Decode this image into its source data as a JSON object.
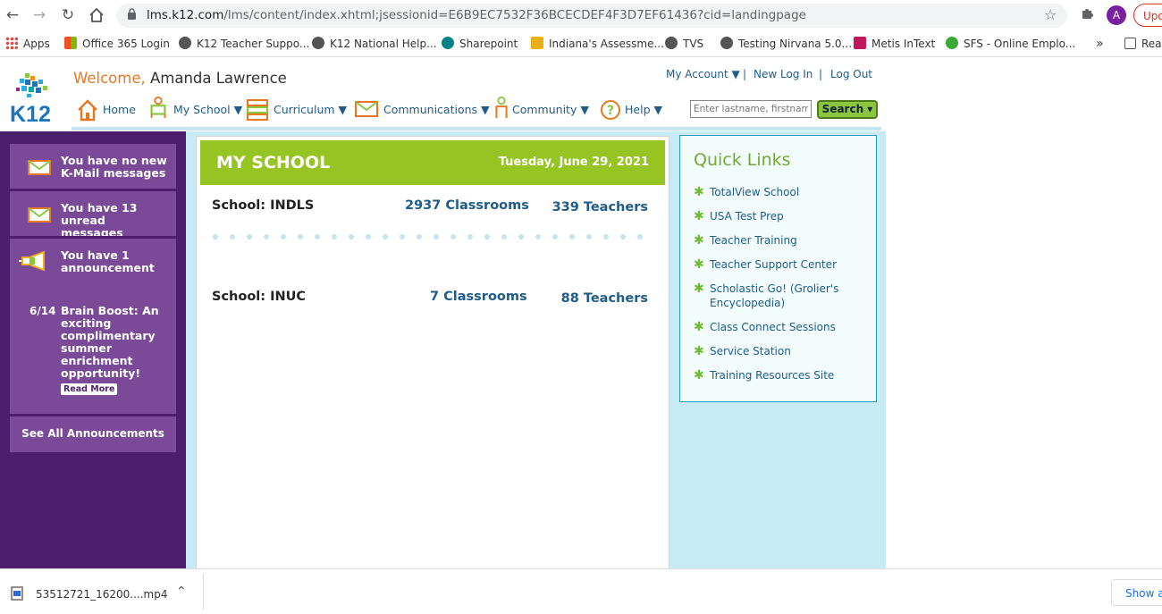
{
  "browser": {
    "url_domain": "lms.k12.com",
    "url_path": "/lms/content/index.xhtml;jsessionid=E6B9EC7532F36BCECDEF4F3D7EF61436?cid=landingpage",
    "avatar_letter": "A",
    "update_label": "Upd",
    "bookmarks": [
      {
        "label": "Apps",
        "color": "#e8453c"
      },
      {
        "label": "Office 365 Login",
        "color": "#f25022"
      },
      {
        "label": "K12 Teacher Suppo...",
        "color": "#555555"
      },
      {
        "label": "K12 National Help...",
        "color": "#555555"
      },
      {
        "label": "Sharepoint",
        "color": "#038387"
      },
      {
        "label": "Indiana's Assessme...",
        "color": "#222222"
      },
      {
        "label": "TVS",
        "color": "#555555"
      },
      {
        "label": "Testing Nirvana 5.0...",
        "color": "#555555"
      },
      {
        "label": "Metis InText",
        "color": "#c2185b"
      },
      {
        "label": "SFS - Online Emplo...",
        "color": "#3aaa35"
      },
      {
        "label": "Rea",
        "color": "#555555"
      }
    ],
    "more_chevron": "»"
  },
  "header": {
    "logo_text": "K12",
    "welcome_word": "Welcome,",
    "user_name": "Amanda Lawrence",
    "my_account": "My Account ▼",
    "sep": "|",
    "new_login": "New Log In",
    "logout": "Log Out"
  },
  "nav": {
    "home": "Home",
    "my_school": "My School ▼",
    "curriculum": "Curriculum ▼",
    "communications": "Communications ▼",
    "community": "Community ▼",
    "help": "Help ▼",
    "search_placeholder": "Enter lastname, firstname",
    "search_button": "Search ▾"
  },
  "left": {
    "kmail": "You have no new K-Mail messages",
    "unread": "You have 13 unread messages",
    "announcement": "You have 1 announcement",
    "ann_date": "6/14",
    "ann_text": "Brain Boost: An exciting complimentary summer enrichment opportunity!",
    "read_more": "Read More",
    "see_all": "See All Announcements"
  },
  "main": {
    "title": "MY SCHOOL",
    "date": "Tuesday, June 29, 2021",
    "schools": [
      {
        "name": "School: INDLS",
        "classrooms": "2937 Classrooms",
        "teachers": "339 Teachers"
      },
      {
        "name": "School: INUC",
        "classrooms": "7 Classrooms",
        "teachers": "88 Teachers"
      }
    ]
  },
  "quick_links": {
    "title": "Quick Links",
    "items": [
      "TotalView School",
      "USA Test Prep",
      "Teacher Training",
      "Teacher Support Center",
      "Scholastic Go! (Grolier's Encyclopedia)",
      "Class Connect Sessions",
      "Service Station",
      "Training Resources Site"
    ]
  },
  "download": {
    "filename": "53512721_16200....mp4",
    "show_all": "Show al"
  },
  "colors": {
    "brand_purple": "#4e1e6e",
    "panel_purple": "#7a4a99",
    "green": "#95c423",
    "link_blue": "#1f5c8a",
    "orange": "#e87722"
  }
}
